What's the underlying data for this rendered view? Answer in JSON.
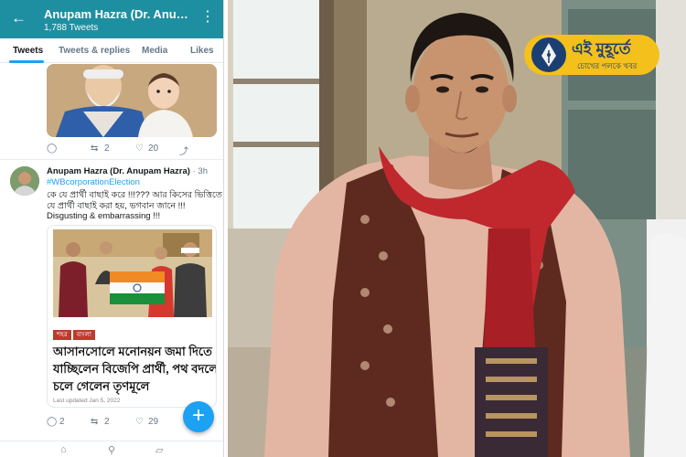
{
  "appbar": {
    "title": "Anupam Hazra (Dr. Anupa…",
    "tweet_count": "1,788 Tweets"
  },
  "tabs": [
    "Tweets",
    "Tweets & replies",
    "Media",
    "Likes"
  ],
  "tweet1": {
    "retweets": "2",
    "likes": "20"
  },
  "tweet2": {
    "author": "Anupam Hazra (Dr. Anupam Hazra)",
    "time": "· 3h",
    "hashtag": "#WBcorporationElection",
    "text_lines": [
      "কে যে প্রার্থী বাছাই করে !!!??? আর কিসের ভিত্তিতে",
      "যে প্রার্থী বাছাই করা হয়, ভগবান জানে !!!",
      "Disgusting & embarrassing !!!"
    ],
    "card": {
      "tags": [
        "শহর",
        "বাংলা"
      ],
      "headline_lines": [
        "আসানসোলে মনোনয়ন জমা দিতে",
        "যাচ্ছিলেন বিজেপি প্রার্থী, পথ বদলে",
        "চলে গেলেন তৃণমূলে"
      ],
      "updated": "Last updated  Jan 5, 2022"
    },
    "replies": "2",
    "retweets": "2",
    "likes": "29"
  },
  "fab": {
    "label": "+"
  },
  "logo": {
    "main": "এই মুহূর্তে",
    "sub": "চোখের পলকে খবর"
  },
  "colors": {
    "appbar": "#1e8fa1",
    "twitter_blue": "#1da1f2",
    "logo_yellow": "#f4c01b",
    "logo_navy": "#1c3f73"
  }
}
